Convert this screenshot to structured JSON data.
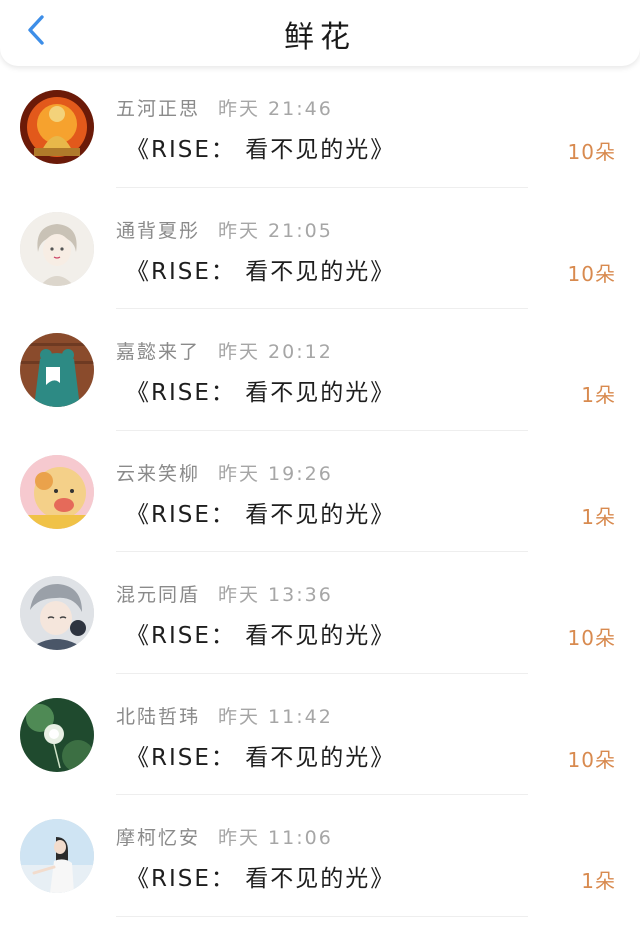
{
  "header": {
    "title": "鲜花"
  },
  "icons": {
    "back": "chevron-left-icon"
  },
  "colors": {
    "accent": "#3d8ee8",
    "count": "#d88a4f"
  },
  "items": [
    {
      "name": "五河正思",
      "time": "昨天 21:46",
      "gift": "《RISE： 看不见的光》",
      "count": "10朵"
    },
    {
      "name": "通背夏彤",
      "time": "昨天 21:05",
      "gift": "《RISE： 看不见的光》",
      "count": "10朵"
    },
    {
      "name": "嘉懿来了",
      "time": "昨天 20:12",
      "gift": "《RISE： 看不见的光》",
      "count": "1朵"
    },
    {
      "name": "云来笑柳",
      "time": "昨天 19:26",
      "gift": "《RISE： 看不见的光》",
      "count": "1朵"
    },
    {
      "name": "混元同盾",
      "time": "昨天 13:36",
      "gift": "《RISE： 看不见的光》",
      "count": "10朵"
    },
    {
      "name": "北陆哲玮",
      "time": "昨天 11:42",
      "gift": "《RISE： 看不见的光》",
      "count": "10朵"
    },
    {
      "name": "摩柯忆安",
      "time": "昨天 11:06",
      "gift": "《RISE： 看不见的光》",
      "count": "1朵"
    }
  ]
}
